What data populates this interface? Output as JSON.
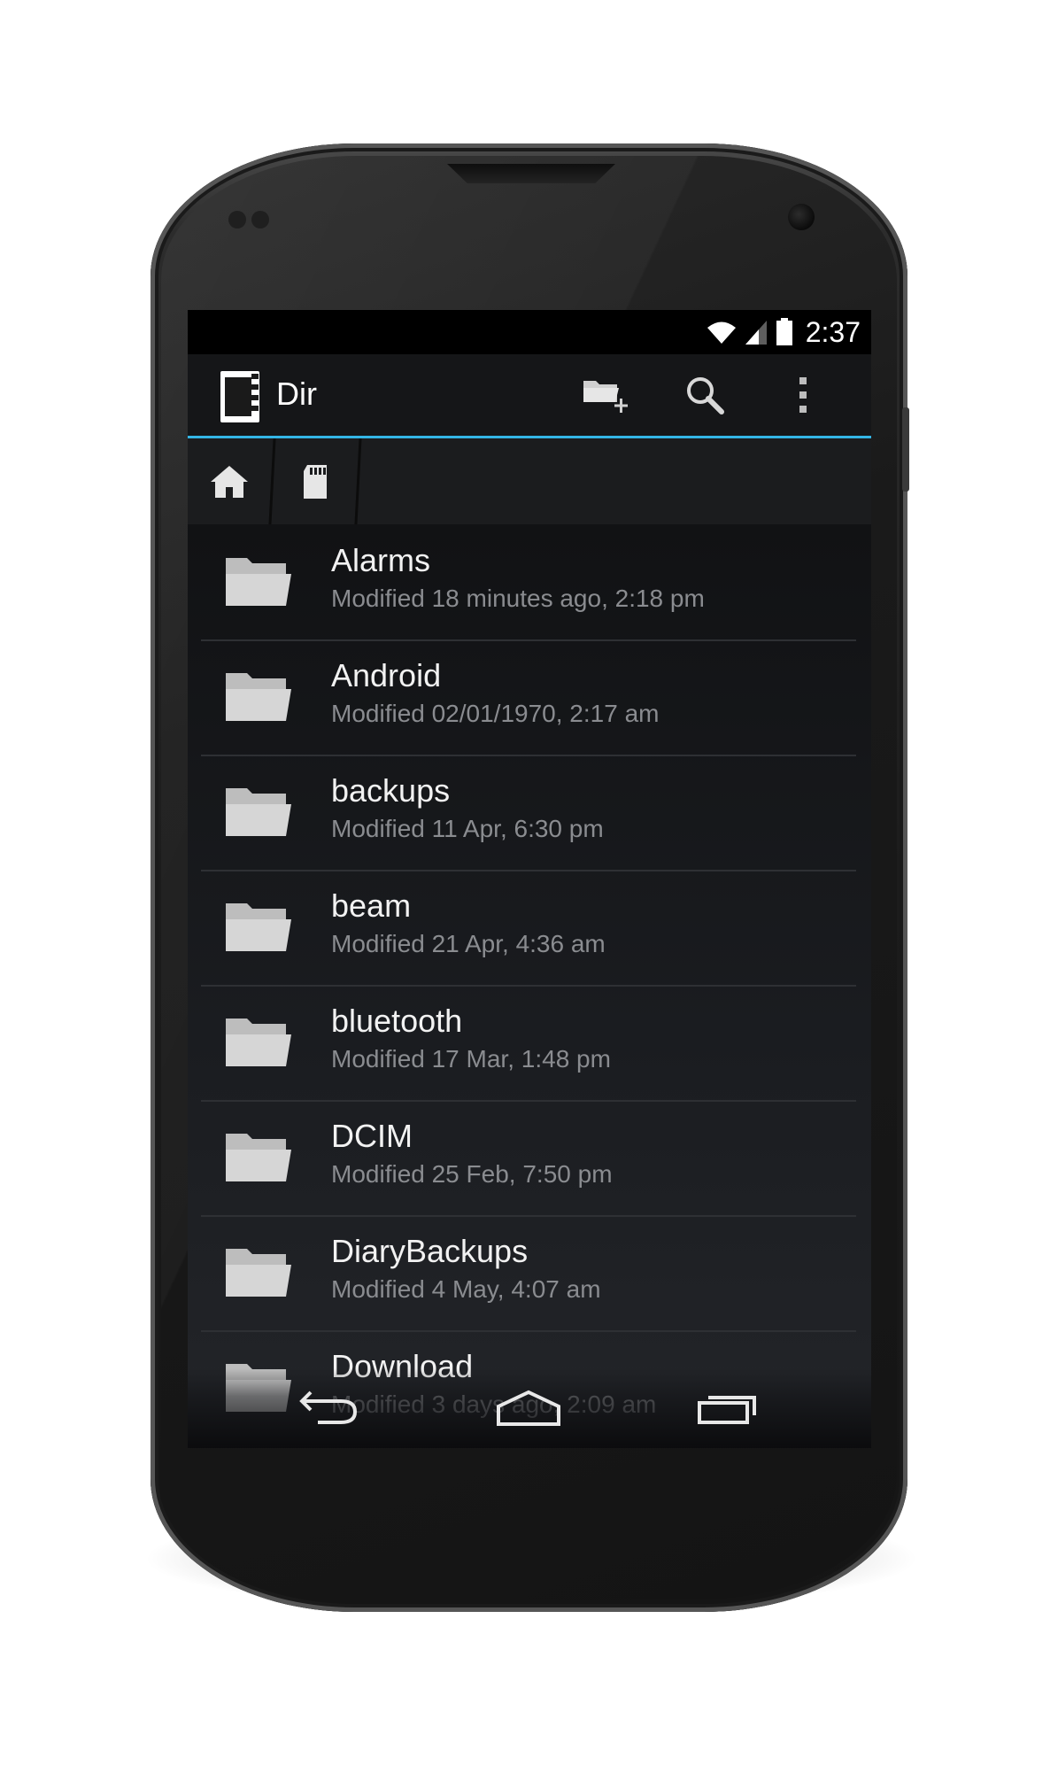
{
  "status_bar": {
    "time": "2:37",
    "icons": [
      "wifi-icon",
      "signal-icon",
      "battery-icon"
    ]
  },
  "action_bar": {
    "title": "Dir",
    "accent_color": "#33b5e5",
    "actions": [
      "new-folder-icon",
      "search-icon",
      "overflow-menu-icon"
    ]
  },
  "breadcrumb": {
    "items": [
      "home-icon",
      "sd-card-icon"
    ]
  },
  "files": [
    {
      "name": "Alarms",
      "modified": "Modified 18 minutes ago, 2:18 pm"
    },
    {
      "name": "Android",
      "modified": "Modified 02/01/1970, 2:17 am"
    },
    {
      "name": "backups",
      "modified": "Modified 11 Apr, 6:30 pm"
    },
    {
      "name": "beam",
      "modified": "Modified 21 Apr, 4:36 am"
    },
    {
      "name": "bluetooth",
      "modified": "Modified 17 Mar, 1:48 pm"
    },
    {
      "name": "DCIM",
      "modified": "Modified 25 Feb, 7:50 pm"
    },
    {
      "name": "DiaryBackups",
      "modified": "Modified 4 May, 4:07 am"
    },
    {
      "name": "Download",
      "modified": "Modified 3 days ago, 2:09 am"
    }
  ],
  "nav_bar": {
    "buttons": [
      "back-icon",
      "home-icon",
      "recents-icon"
    ]
  }
}
